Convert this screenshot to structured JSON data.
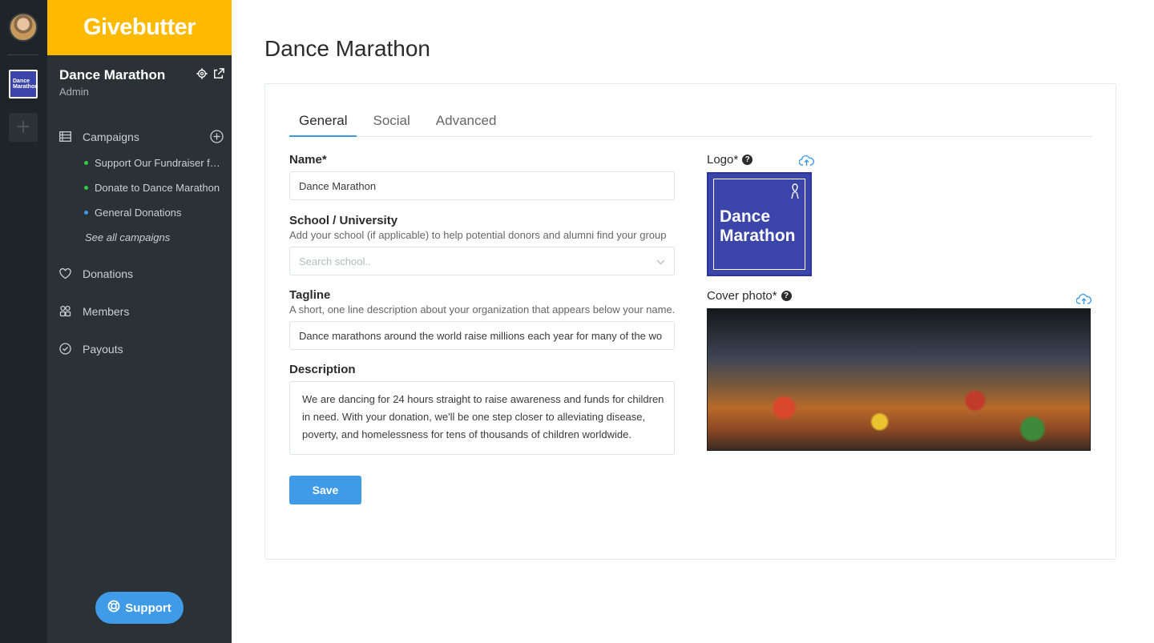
{
  "brand": {
    "name": "Givebutter"
  },
  "rail": {
    "org_thumb_text": "Dance Marathon"
  },
  "org": {
    "name": "Dance Marathon",
    "role": "Admin"
  },
  "nav": {
    "campaigns": "Campaigns",
    "campaign_items": [
      {
        "label": "Support Our Fundraiser f…",
        "status_color": "#2ecc40"
      },
      {
        "label": "Donate to Dance Marathon",
        "status_color": "#2ecc40"
      },
      {
        "label": "General Donations",
        "status_color": "#3f9ae8"
      }
    ],
    "see_all": "See all campaigns",
    "donations": "Donations",
    "members": "Members",
    "payouts": "Payouts"
  },
  "support": {
    "label": "Support"
  },
  "page": {
    "title": "Dance Marathon"
  },
  "tabs": [
    {
      "label": "General",
      "active": true
    },
    {
      "label": "Social",
      "active": false
    },
    {
      "label": "Advanced",
      "active": false
    }
  ],
  "form": {
    "name_label": "Name*",
    "name_value": "Dance Marathon",
    "school_label": "School / University",
    "school_help": "Add your school (if applicable) to help potential donors and alumni find your group",
    "school_placeholder": "Search school..",
    "tagline_label": "Tagline",
    "tagline_help": "A short, one line description about your organization that appears below your name.",
    "tagline_value": "Dance marathons around the world raise millions each year for many of the wo",
    "description_label": "Description",
    "description_value": "We are dancing for 24 hours straight to raise awareness and funds for children in need. With your donation, we'll be one step closer to alleviating disease, poverty, and homelessness for tens of thousands of children worldwide.",
    "save_label": "Save"
  },
  "media": {
    "logo_label": "Logo*",
    "logo_text": "Dance Marathon",
    "cover_label": "Cover photo*"
  },
  "colors": {
    "accent": "#3f9ae8",
    "brand": "#ffba00",
    "sidebar": "#2b3236",
    "rail": "#1e2428"
  }
}
